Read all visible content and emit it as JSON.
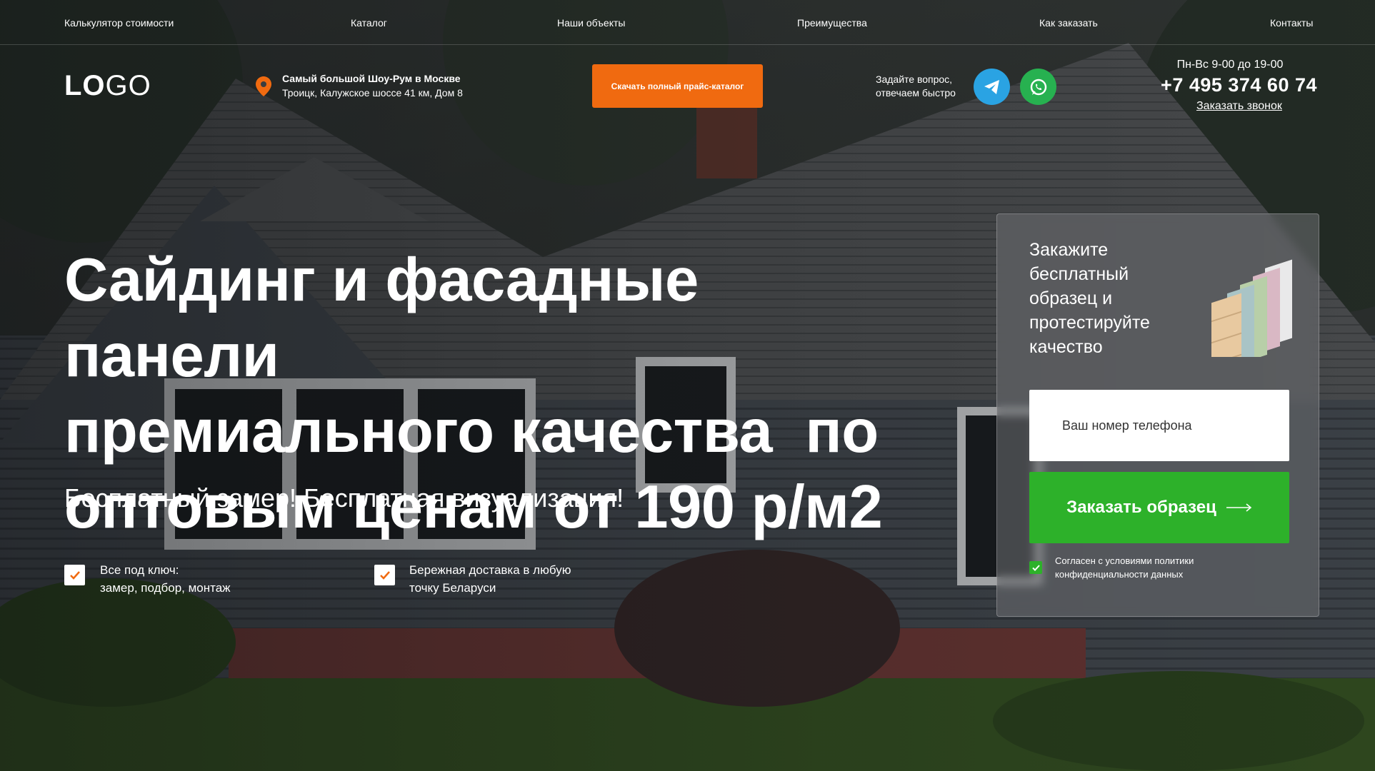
{
  "nav": [
    "Калькулятор стоимости",
    "Каталог",
    "Наши объекты",
    "Преимущества",
    "Как заказать",
    "Контакты"
  ],
  "header": {
    "logo_bold": "LO",
    "logo_light": "GO",
    "showroom_title": "Самый большой Шоу-Рум в Москве",
    "showroom_address": "Троицк, Калужское шоссе 41 км, Дом 8",
    "price_button": "Скачать полный прайс-каталог",
    "ask_line1": "Задайте вопрос,",
    "ask_line2": "отвечаем быстро",
    "hours": "Пн-Вс 9-00 до 19-00",
    "phone": "+7 495 374 60 74",
    "callback": "Заказать звонок"
  },
  "hero": {
    "line1": "Сайдинг и фасадные панели",
    "line2": "премиального качества  по",
    "line3": "оптовым ценам от 190 р/м2",
    "subtitle": "Бесплатный замер! Бесплатная визуализация!",
    "features": [
      {
        "line1": "Все под ключ:",
        "line2": "замер, подбор, монтаж"
      },
      {
        "line1": "Бережная доставка в любую",
        "line2": "точку Беларуси"
      }
    ]
  },
  "card": {
    "title": "Закажите бесплатный образец и протестируйте качество",
    "phone_placeholder": "Ваш номер телефона",
    "order_button": "Заказать образец",
    "agree_text": "Согласен с условиями политики конфиденциальности данных"
  },
  "colors": {
    "accent_orange": "#f06a10",
    "accent_green": "#2db12a",
    "telegram": "#2aa3e3",
    "whatsapp": "#27b150"
  },
  "icons": {
    "location": "map-pin-icon",
    "telegram": "telegram-icon",
    "whatsapp": "whatsapp-icon",
    "check": "check-icon",
    "arrow": "arrow-right-icon"
  }
}
